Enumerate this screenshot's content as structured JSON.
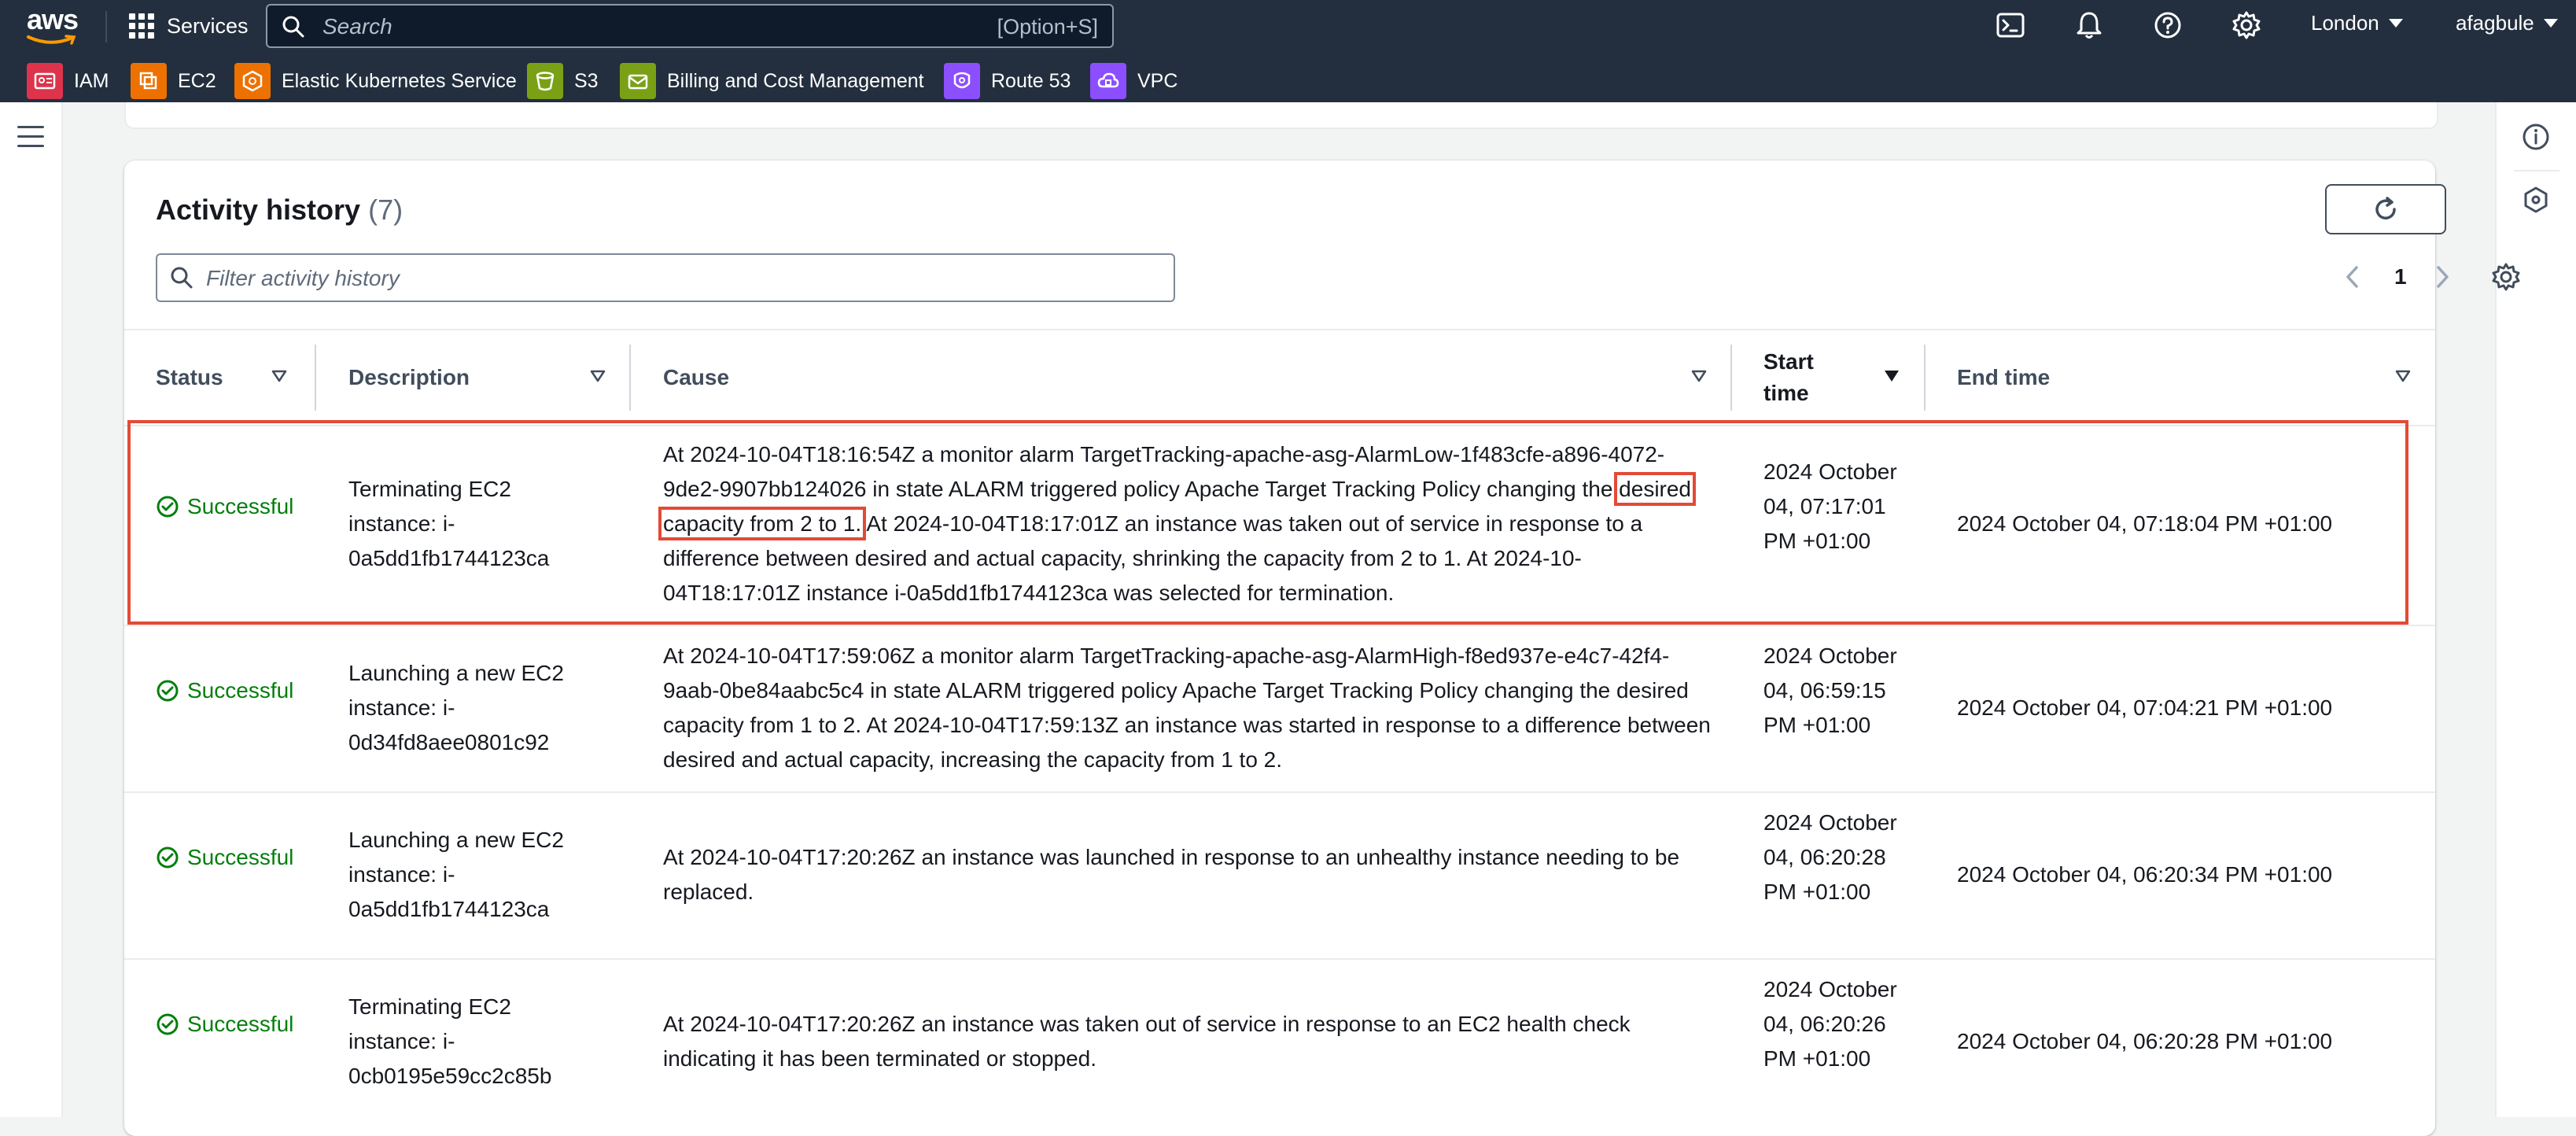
{
  "topnav": {
    "logo_text": "aws",
    "services_label": "Services",
    "search_placeholder": "Search",
    "search_shortcut": "[Option+S]",
    "region": "London",
    "account": "afagbule",
    "favorites": [
      {
        "label": "IAM",
        "color": "#dd344c"
      },
      {
        "label": "EC2",
        "color": "#ed7100"
      },
      {
        "label": "Elastic Kubernetes Service",
        "color": "#ed7100"
      },
      {
        "label": "S3",
        "color": "#7aa116"
      },
      {
        "label": "Billing and Cost Management",
        "color": "#7aa116"
      },
      {
        "label": "Route 53",
        "color": "#8c4fff"
      },
      {
        "label": "VPC",
        "color": "#8c4fff"
      }
    ]
  },
  "activity": {
    "title": "Activity history",
    "count": "(7)",
    "filter_placeholder": "Filter activity history",
    "page": "1",
    "columns": {
      "status": "Status",
      "description": "Description",
      "cause": "Cause",
      "start_time": "Start time",
      "end_time": "End time"
    },
    "rows": [
      {
        "status": "Successful",
        "description": "Terminating EC2 instance: i-0a5dd1fb1744123ca",
        "cause_before": "At 2024-10-04T18:16:54Z a monitor alarm TargetTracking-apache-asg-AlarmLow-1f483cfe-a896-4072-9de2-9907bb124026 in state ALARM triggered policy Apache Target Tracking Policy changing the ",
        "cause_highlight": "desired capacity from 2 to 1.",
        "cause_after": " At 2024-10-04T18:17:01Z an instance was taken out of service in response to a difference between desired and actual capacity, shrinking the capacity from 2 to 1. At 2024-10-04T18:17:01Z instance i-0a5dd1fb1744123ca was selected for termination.",
        "start_time": "2024 October 04, 07:17:01 PM +01:00",
        "end_time": "2024 October 04, 07:18:04 PM +01:00"
      },
      {
        "status": "Successful",
        "description": "Launching a new EC2 instance: i-0d34fd8aee0801c92",
        "cause_before": "At 2024-10-04T17:59:06Z a monitor alarm TargetTracking-apache-asg-AlarmHigh-f8ed937e-e4c7-42f4-9aab-0be84aabc5c4 in state ALARM triggered policy Apache Target Tracking Policy changing the desired capacity from 1 to 2. At 2024-10-04T17:59:13Z an instance was started in response to a difference between desired and actual capacity, increasing the capacity from 1 to 2.",
        "cause_highlight": "",
        "cause_after": "",
        "start_time": "2024 October 04, 06:59:15 PM +01:00",
        "end_time": "2024 October 04, 07:04:21 PM +01:00"
      },
      {
        "status": "Successful",
        "description": "Launching a new EC2 instance: i-0a5dd1fb1744123ca",
        "cause_before": "At 2024-10-04T17:20:26Z an instance was launched in response to an unhealthy instance needing to be replaced.",
        "cause_highlight": "",
        "cause_after": "",
        "start_time": "2024 October 04, 06:20:28 PM +01:00",
        "end_time": "2024 October 04, 06:20:34 PM +01:00"
      },
      {
        "status": "Successful",
        "description": "Terminating EC2 instance: i-0cb0195e59cc2c85b",
        "cause_before": "At 2024-10-04T17:20:26Z an instance was taken out of service in response to an EC2 health check indicating it has been terminated or stopped.",
        "cause_highlight": "",
        "cause_after": "",
        "start_time": "2024 October 04, 06:20:26 PM +01:00",
        "end_time": "2024 October 04, 06:20:28 PM +01:00"
      }
    ]
  }
}
